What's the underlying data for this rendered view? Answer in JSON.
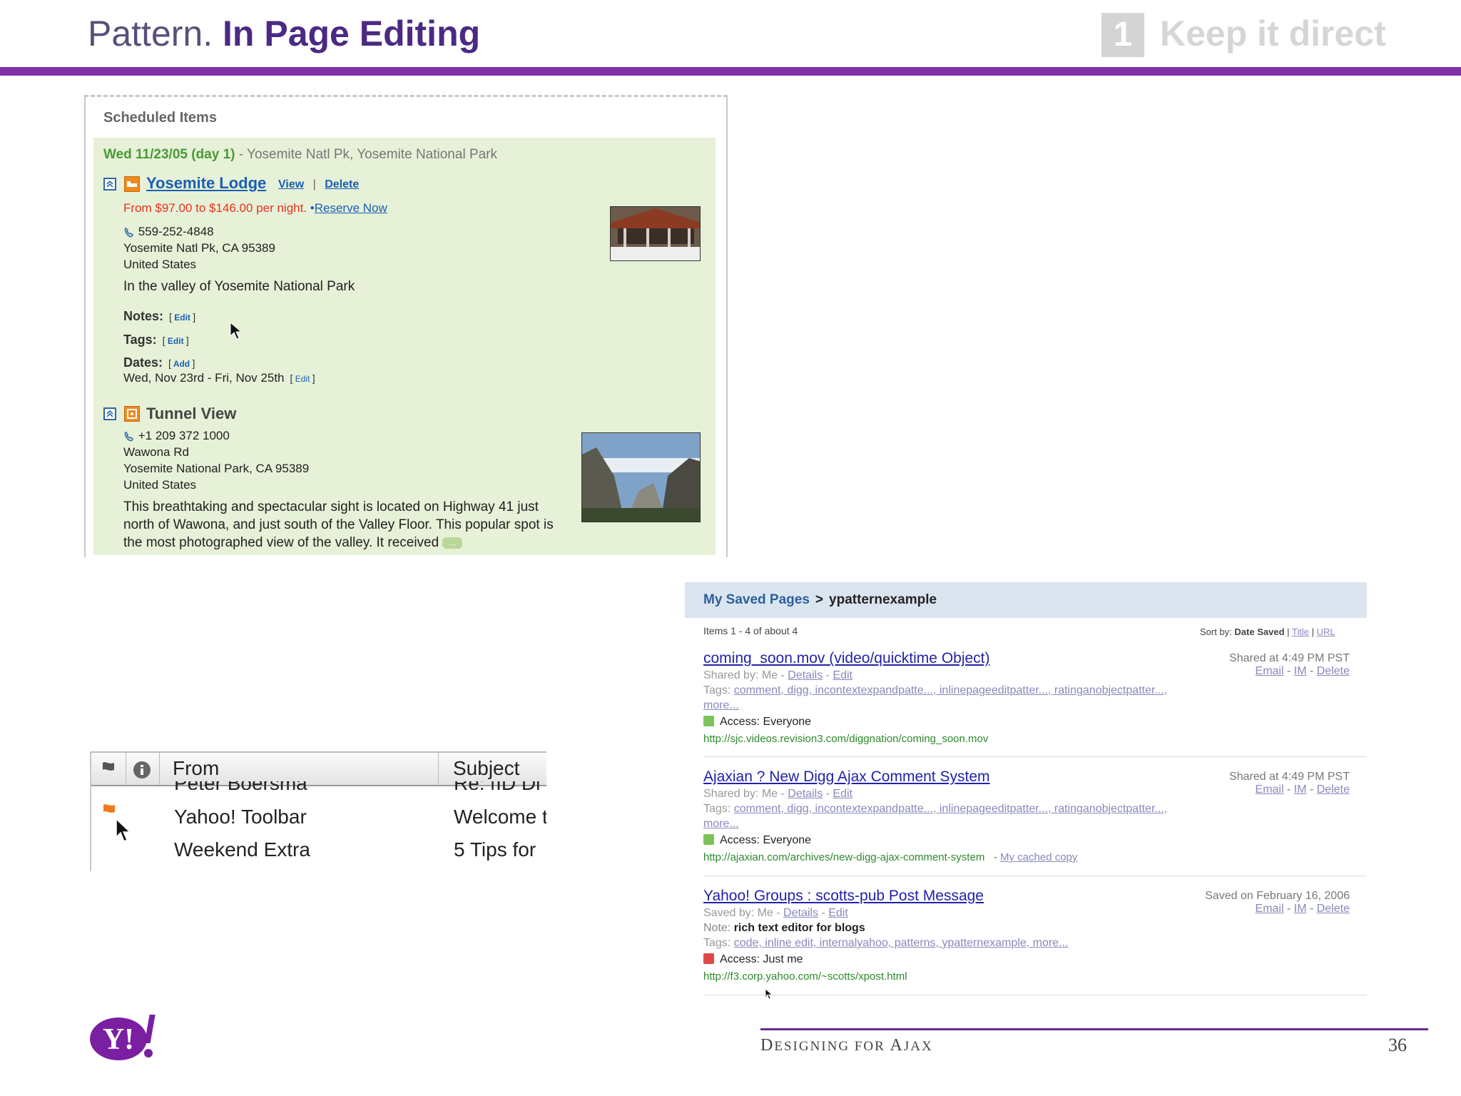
{
  "slide": {
    "title_prefix": "Pattern.",
    "title_bold": "In Page Editing",
    "step_number": "1",
    "step_label": "Keep it direct",
    "accent": "#7e2fa5"
  },
  "scheduled": {
    "heading": "Scheduled Items",
    "day_label": "Wed 11/23/05 (day 1)",
    "day_location": " - Yosemite Natl Pk, Yosemite National Park",
    "lodge": {
      "title": "Yosemite Lodge",
      "view": "View",
      "delete": "Delete",
      "price": "From $97.00 to $146.00 per night.",
      "reserve_prefix": "•",
      "reserve": "Reserve Now",
      "phone": "559-252-4848",
      "city": "Yosemite Natl Pk, CA 95389",
      "country": "United States",
      "description": "In the valley of Yosemite National Park",
      "notes_label": "Notes:",
      "tags_label": "Tags:",
      "dates_label": "Dates:",
      "edit": "Edit",
      "add": "Add",
      "date_range": "Wed, Nov 23rd - Fri, Nov 25th"
    },
    "tunnel": {
      "title": "Tunnel View",
      "phone": "+1 209 372 1000",
      "street": "Wawona Rd",
      "city": "Yosemite National Park, CA 95389",
      "country": "United States",
      "description": "This breathtaking and spectacular sight is located on Highway 41 just north of Wawona, and just south of the Valley Floor. This popular spot is the most photographed view of the valley. It received",
      "more": "..."
    }
  },
  "mail": {
    "col_from": "From",
    "col_subject": "Subject",
    "rows": [
      {
        "from": "Peter Boersma",
        "subject": "Re: [ID Di"
      },
      {
        "from": "Yahoo! Toolbar",
        "subject": "Welcome t"
      },
      {
        "from": "Weekend Extra",
        "subject": "5 Tips for"
      }
    ]
  },
  "saved": {
    "crumb_home": "My Saved Pages",
    "crumb_sep": ">",
    "crumb_current": "ypatternexample",
    "items_text": "Items 1 - 4 of about 4",
    "sort_label": "Sort by:",
    "sort_active": "Date Saved",
    "sort_title": "Title",
    "sort_url": "URL",
    "results": [
      {
        "title": "coming_soon.mov (video/quicktime Object)",
        "by": "Shared by: Me -",
        "details": "Details",
        "edit": "Edit",
        "tags_label": "Tags:",
        "tags": "comment, digg, incontextexpandpatte..., inlinepageeditpatter..., ratinganobjectpatter...,",
        "more": "more...",
        "access": "Access: Everyone",
        "url": "http://sjc.videos.revision3.com/diggnation/coming_soon.mov",
        "when": "Shared at 4:49 PM PST",
        "email": "Email",
        "im": "IM",
        "delete": "Delete"
      },
      {
        "title": "Ajaxian ? New Digg Ajax Comment System",
        "by": "Shared by: Me -",
        "details": "Details",
        "edit": "Edit",
        "tags_label": "Tags:",
        "tags": "comment, digg, incontextexpandpatte..., inlinepageeditpatter..., ratinganobjectpatter...,",
        "more": "more...",
        "access": "Access: Everyone",
        "url": "http://ajaxian.com/archives/new-digg-ajax-comment-system",
        "cached": "My cached copy",
        "when": "Shared at 4:49 PM PST",
        "email": "Email",
        "im": "IM",
        "delete": "Delete"
      },
      {
        "title": "Yahoo! Groups : scotts-pub Post Message",
        "by": "Saved by: Me -",
        "details": "Details",
        "edit": "Edit",
        "note_label": "Note:",
        "note": "rich text editor for blogs",
        "tags_label": "Tags:",
        "tags": "code, inline edit, internalyahoo, patterns, ypatternexample, more...",
        "access": "Access: Just me",
        "url": "http://f3.corp.yahoo.com/~scotts/xpost.html",
        "when": "Saved on February 16, 2006",
        "email": "Email",
        "im": "IM",
        "delete": "Delete"
      }
    ]
  },
  "footer": {
    "title_first": "D",
    "title_rest": "ESIGNING FOR ",
    "title_a": "A",
    "title_jax": "JAX",
    "page": "36",
    "logo": "Y!"
  }
}
